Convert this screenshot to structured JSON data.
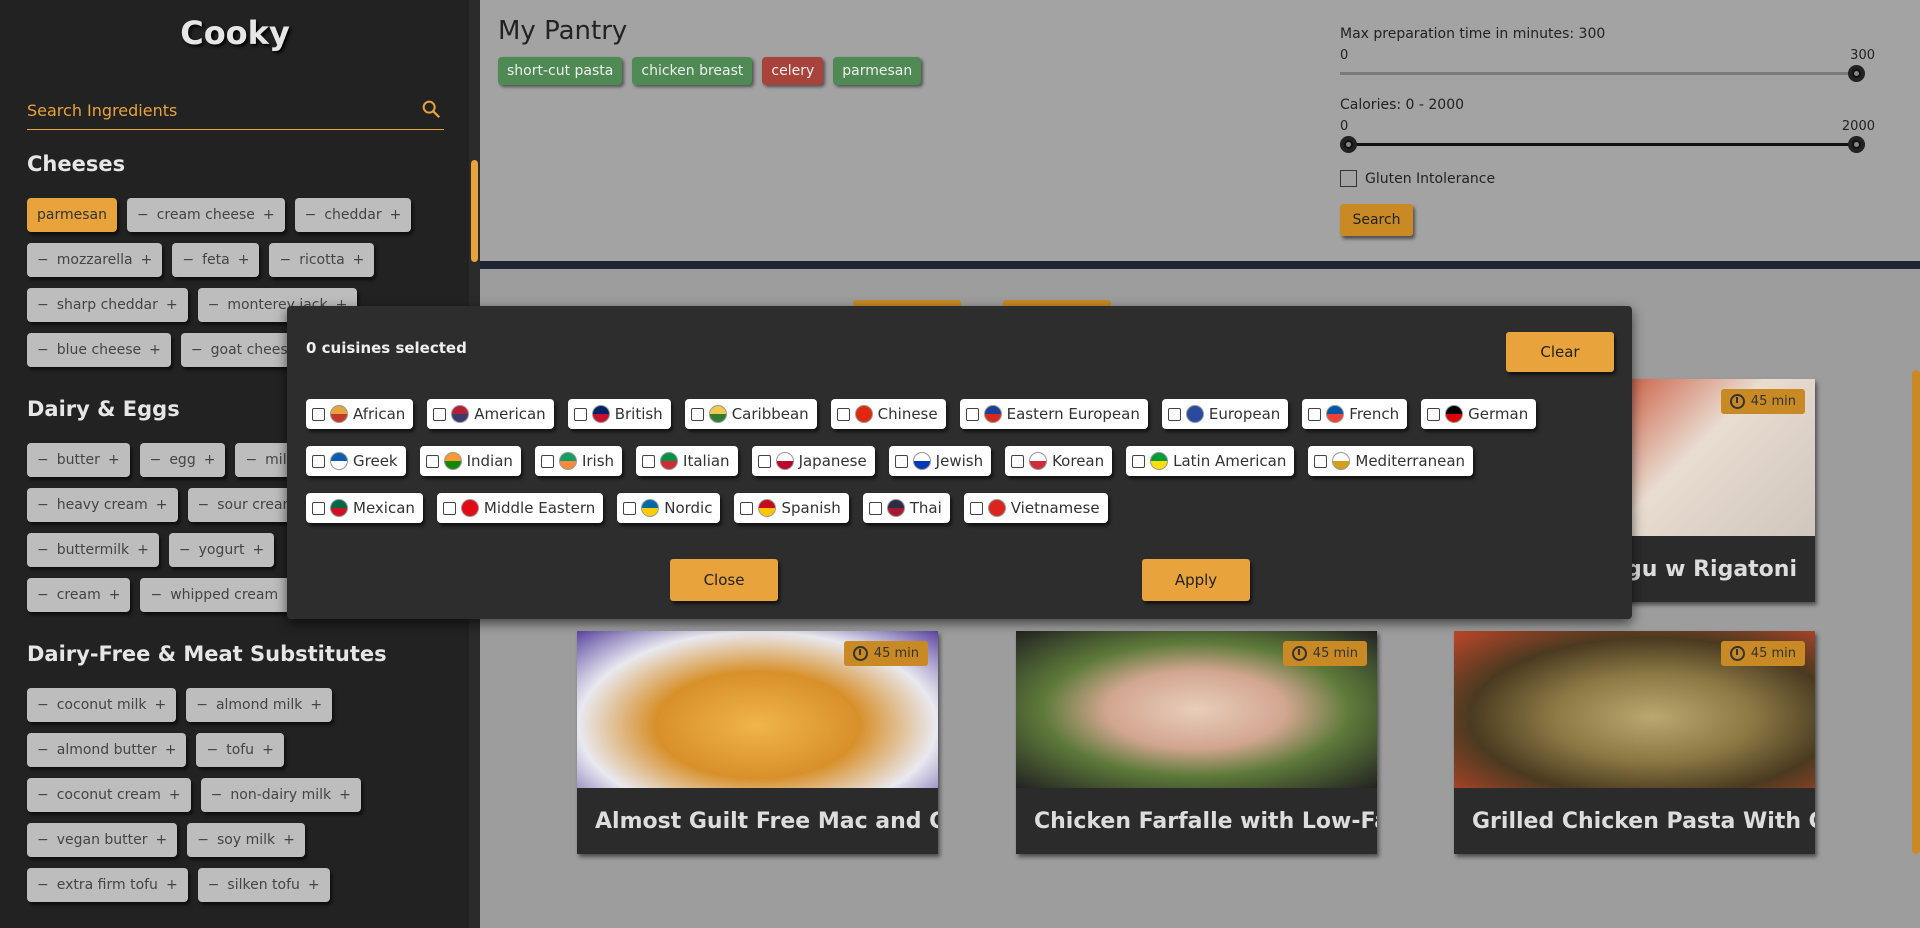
{
  "sidebar": {
    "app_title": "Cooky",
    "search_placeholder": "Search Ingredients",
    "categories": [
      {
        "name": "Cheeses",
        "rows": [
          [
            "parmesan",
            "cream cheese",
            "cheddar"
          ],
          [
            "mozzarella",
            "feta",
            "ricotta"
          ],
          [
            "sharp cheddar",
            "monterey jack"
          ],
          [
            "blue cheese",
            "goat cheese"
          ]
        ]
      },
      {
        "name": "Dairy & Eggs",
        "rows": [
          [
            "butter",
            "egg",
            "milk"
          ],
          [
            "heavy cream",
            "sour cream"
          ],
          [
            "buttermilk",
            "yogurt"
          ],
          [
            "cream",
            "whipped cream"
          ]
        ]
      },
      {
        "name": "Dairy-Free & Meat Substitutes",
        "rows": [
          [
            "coconut milk",
            "almond milk"
          ],
          [
            "almond butter",
            "tofu"
          ],
          [
            "coconut cream",
            "non-dairy milk"
          ],
          [
            "vegan butter",
            "soy milk"
          ],
          [
            "extra firm tofu",
            "silken tofu"
          ]
        ]
      }
    ],
    "selected": "parmesan"
  },
  "pantry": {
    "title": "My Pantry",
    "tags": [
      {
        "label": "short-cut pasta",
        "color": "#4f8a55"
      },
      {
        "label": "chicken breast",
        "color": "#4f8a55"
      },
      {
        "label": "celery",
        "color": "#a8433b"
      },
      {
        "label": "parmesan",
        "color": "#4f8a55"
      }
    ],
    "filters": {
      "prep_label": "Max preparation time in minutes: 300",
      "prep_min": "0",
      "prep_max": "300",
      "prep_value": 300,
      "cal_label": "Calories: 0 - 2000",
      "cal_min": "0",
      "cal_max": "2000",
      "cal_range": [
        0,
        2000
      ],
      "gluten_label": "Gluten Intolerance",
      "gluten_checked": false,
      "search_label": "Search"
    }
  },
  "recipes": [
    {
      "title": "…gu w Rigatoni",
      "time": "45 min"
    },
    {
      "title": "Almost Guilt Free Mac and Che...",
      "time": "45 min"
    },
    {
      "title": "Chicken Farfalle with Low-Fat A...",
      "time": "45 min"
    },
    {
      "title": "Grilled Chicken Pasta With Gorg...",
      "time": "45 min"
    }
  ],
  "modal": {
    "count_label": "0 cuisines selected",
    "clear_label": "Clear",
    "close_label": "Close",
    "apply_label": "Apply",
    "cuisine_rows": [
      [
        {
          "name": "African",
          "colors": [
            "#e8a33c",
            "#c0392b"
          ]
        },
        {
          "name": "American",
          "colors": [
            "#b22234",
            "#3c3b6e"
          ]
        },
        {
          "name": "British",
          "colors": [
            "#012169",
            "#c8102e"
          ]
        },
        {
          "name": "Caribbean",
          "colors": [
            "#f2c94c",
            "#2e7d32"
          ]
        },
        {
          "name": "Chinese",
          "colors": [
            "#de2910",
            "#de2910"
          ]
        },
        {
          "name": "Eastern European",
          "colors": [
            "#1c3f94",
            "#d52b1e"
          ]
        },
        {
          "name": "European",
          "colors": [
            "#2a4aa0",
            "#2a4aa0"
          ]
        },
        {
          "name": "French",
          "colors": [
            "#0055a4",
            "#ef4135"
          ]
        },
        {
          "name": "German",
          "colors": [
            "#000000",
            "#dd0000"
          ]
        }
      ],
      [
        {
          "name": "Greek",
          "colors": [
            "#0d5eaf",
            "#ffffff"
          ]
        },
        {
          "name": "Indian",
          "colors": [
            "#ff9933",
            "#138808"
          ]
        },
        {
          "name": "Irish",
          "colors": [
            "#169b62",
            "#ff883e"
          ]
        },
        {
          "name": "Italian",
          "colors": [
            "#009246",
            "#ce2b37"
          ]
        },
        {
          "name": "Japanese",
          "colors": [
            "#ffffff",
            "#bc002d"
          ]
        },
        {
          "name": "Jewish",
          "colors": [
            "#ffffff",
            "#0038b8"
          ]
        },
        {
          "name": "Korean",
          "colors": [
            "#ffffff",
            "#cd2e3a"
          ]
        },
        {
          "name": "Latin American",
          "colors": [
            "#009c3b",
            "#ffdf00"
          ]
        },
        {
          "name": "Mediterranean",
          "colors": [
            "#ffffff",
            "#d4a017"
          ]
        }
      ],
      [
        {
          "name": "Mexican",
          "colors": [
            "#006847",
            "#ce1126"
          ]
        },
        {
          "name": "Middle Eastern",
          "colors": [
            "#e30a17",
            "#e30a17"
          ]
        },
        {
          "name": "Nordic",
          "colors": [
            "#006aa7",
            "#fecc00"
          ]
        },
        {
          "name": "Spanish",
          "colors": [
            "#c60b1e",
            "#ffc400"
          ]
        },
        {
          "name": "Thai",
          "colors": [
            "#2d2a4a",
            "#a51931"
          ]
        },
        {
          "name": "Vietnamese",
          "colors": [
            "#da251d",
            "#da251d"
          ]
        }
      ]
    ]
  }
}
